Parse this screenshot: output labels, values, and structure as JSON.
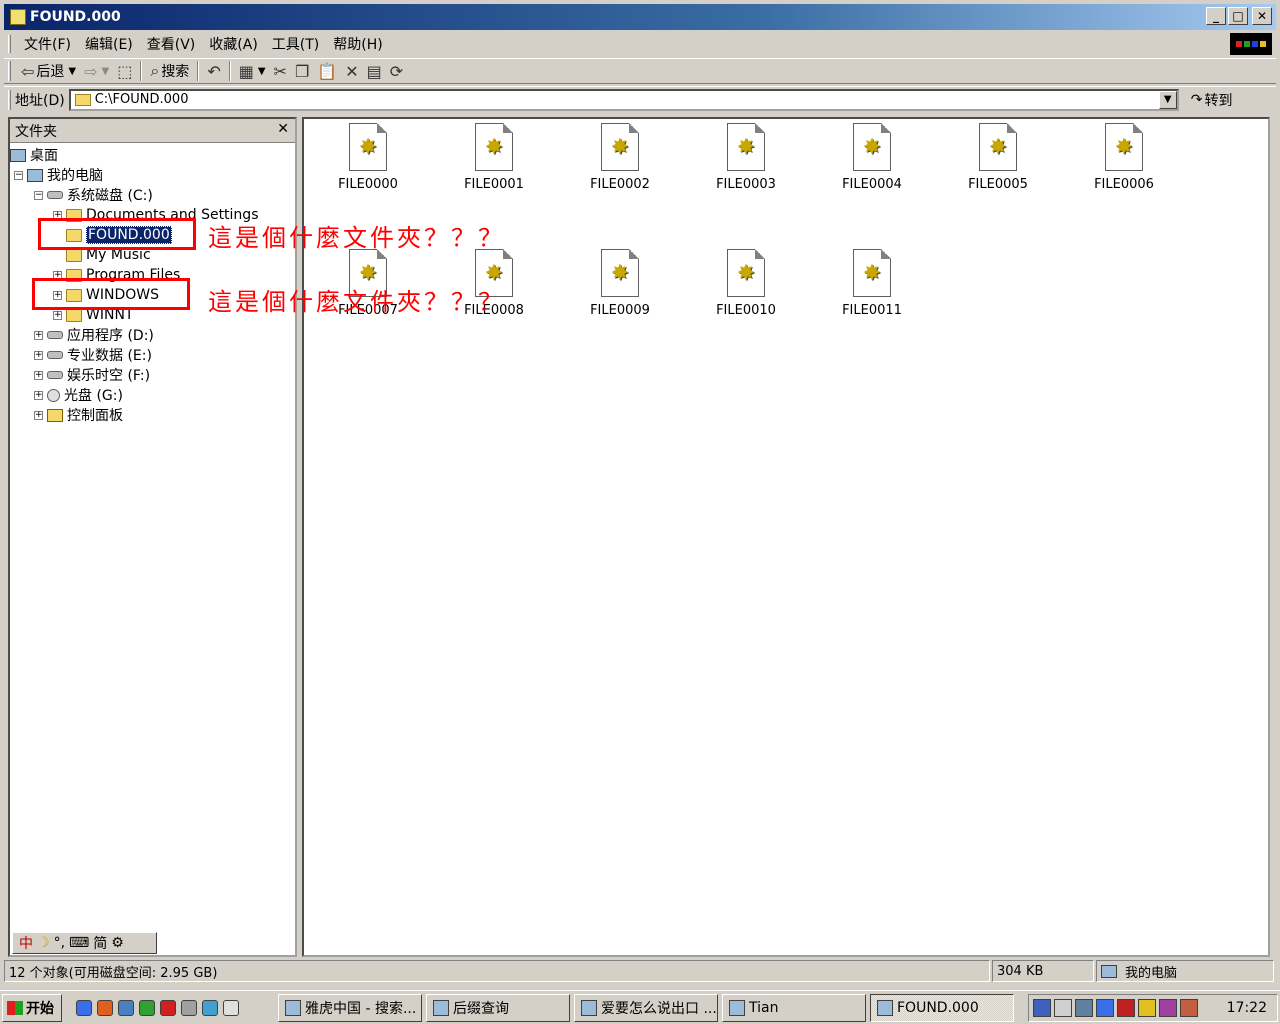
{
  "window": {
    "title": "FOUND.000",
    "minimize_glyph": "_",
    "maximize_glyph": "□",
    "close_glyph": "✕"
  },
  "menu": [
    "文件(F)",
    "编辑(E)",
    "查看(V)",
    "收藏(A)",
    "工具(T)",
    "帮助(H)"
  ],
  "toolbar": {
    "back_label": "后退",
    "search_label": "搜索"
  },
  "address": {
    "label": "地址(D)",
    "value": "C:\\FOUND.000",
    "go_label": "转到"
  },
  "folders_pane": {
    "title": "文件夹",
    "close_glyph": "✕"
  },
  "tree": {
    "desktop": "桌面",
    "my_computer": "我的电脑",
    "drive_c": "系统磁盘 (C:)",
    "docs_settings": "Documents and Settings",
    "found": "FOUND.000",
    "my_music": "My Music",
    "program_files": "Program Files",
    "windows": "WINDOWS",
    "winnt": "WINNT",
    "drive_d": "应用程序 (D:)",
    "drive_e": "专业数据 (E:)",
    "drive_f": "娱乐时空 (F:)",
    "drive_g": "光盘 (G:)",
    "control_panel": "控制面板"
  },
  "files": [
    "FILE0000",
    "FILE0001",
    "FILE0002",
    "FILE0003",
    "FILE0004",
    "FILE0005",
    "FILE0006",
    "FILE0007",
    "FILE0008",
    "FILE0009",
    "FILE0010",
    "FILE0011"
  ],
  "annotations": {
    "found_note": "這是個什麼文件夾？？？",
    "windows_note": "這是個什麼文件夾？？？"
  },
  "ime": {
    "mode": "中",
    "moon": "☽",
    "punct": "°,",
    "keyboard": "⌨",
    "simplified": "简"
  },
  "status": {
    "objects": "12 个对象(可用磁盘空间: 2.95 GB)",
    "size": "304 KB",
    "location": "我的电脑"
  },
  "taskbar": {
    "start_label": "开始",
    "tasks": [
      "雅虎中国 - 搜索...",
      "后缀查询",
      "爱要怎么说出口 ...",
      "Tian",
      "FOUND.000"
    ],
    "clock": "17:22"
  },
  "colors": {
    "title_active": "#0a246a",
    "selection": "#0a246a",
    "annotation": "#ff0000",
    "chrome": "#d4d0c8"
  }
}
